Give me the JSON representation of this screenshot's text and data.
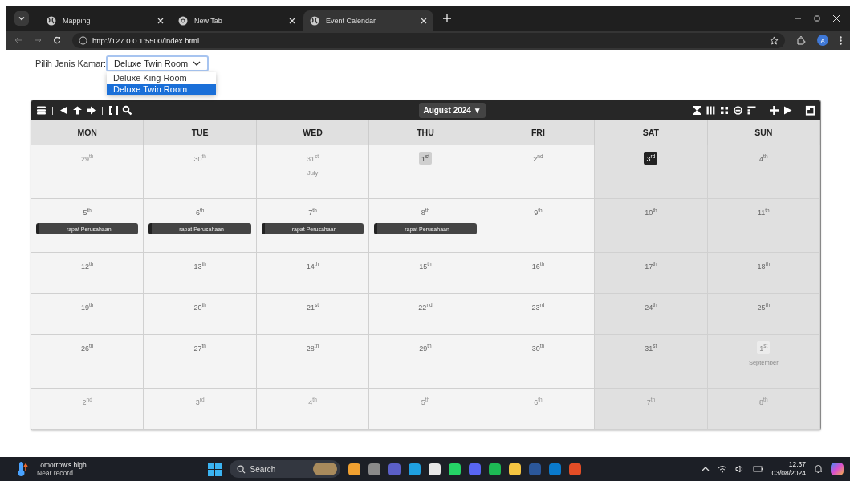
{
  "browser": {
    "tabs": [
      {
        "title": "Mapping",
        "selected": false
      },
      {
        "title": "New Tab",
        "selected": false
      },
      {
        "title": "Event Calendar",
        "selected": true
      }
    ],
    "url": "http://127.0.0.1:5500/index.html",
    "profile": "A"
  },
  "room_picker": {
    "label": "Pilih Jenis Kamar:",
    "value": "Deluxe Twin Room",
    "expanded": true,
    "options": [
      {
        "label": "Deluxe King Room",
        "selected": false
      },
      {
        "label": "Deluxe Twin Room",
        "selected": true
      }
    ]
  },
  "calendar": {
    "month_button": "August 2024 ▼",
    "columns": [
      {
        "label": "MON",
        "weekend": false
      },
      {
        "label": "TUE",
        "weekend": false
      },
      {
        "label": "WED",
        "weekend": false
      },
      {
        "label": "THU",
        "weekend": false
      },
      {
        "label": "FRI",
        "weekend": false
      },
      {
        "label": "SAT",
        "weekend": true
      },
      {
        "label": "SUN",
        "weekend": true
      }
    ],
    "weeks": [
      [
        {
          "label": "29$^{th}$",
          "other_month": true
        },
        {
          "label": "30$^{th}$",
          "other_month": true
        },
        {
          "label": "31$^{st}$",
          "other_month": true,
          "month": "July"
        },
        {
          "label": "1$^{st}$",
          "other_month": false,
          "highlighted": true
        },
        {
          "label": "2$^{nd}$",
          "other_month": false
        },
        {
          "label": "3$^{rd}$",
          "other_month": false,
          "today": true
        },
        {
          "label": "4$^{th}$",
          "other_month": false
        }
      ],
      [
        {
          "label": "5$^{th}$",
          "other_month": false,
          "events": [
            "rapat Perusahaan"
          ]
        },
        {
          "label": "6$^{th}$",
          "other_month": false,
          "events": [
            "rapat Perusahaan"
          ]
        },
        {
          "label": "7$^{th}$",
          "other_month": false,
          "events": [
            "rapat Perusahaan"
          ]
        },
        {
          "label": "8$^{th}$",
          "other_month": false,
          "events": [
            "rapat Perusahaan"
          ]
        },
        {
          "label": "9$^{th}$",
          "other_month": false
        },
        {
          "label": "10$^{th}$",
          "other_month": false
        },
        {
          "label": "11$^{th}$",
          "other_month": false
        }
      ],
      [
        {
          "label": "12$^{th}$",
          "other_month": false
        },
        {
          "label": "13$^{th}$",
          "other_month": false
        },
        {
          "label": "14$^{th}$",
          "other_month": false
        },
        {
          "label": "15$^{th}$",
          "other_month": false
        },
        {
          "label": "16$^{th}$",
          "other_month": false
        },
        {
          "label": "17$^{th}$",
          "other_month": false
        },
        {
          "label": "18$^{th}$",
          "other_month": false
        }
      ],
      [
        {
          "label": "19$^{th}$",
          "other_month": false
        },
        {
          "label": "20$^{th}$",
          "other_month": false
        },
        {
          "label": "21$^{st}$",
          "other_month": false
        },
        {
          "label": "22$^{nd}$",
          "other_month": false
        },
        {
          "label": "23$^{rd}$",
          "other_month": false
        },
        {
          "label": "24$^{th}$",
          "other_month": false
        },
        {
          "label": "25$^{th}$",
          "other_month": false
        }
      ],
      [
        {
          "label": "26$^{th}$",
          "other_month": false
        },
        {
          "label": "27$^{th}$",
          "other_month": false
        },
        {
          "label": "28$^{th}$",
          "other_month": false
        },
        {
          "label": "29$^{th}$",
          "other_month": false
        },
        {
          "label": "30$^{th}$",
          "other_month": false
        },
        {
          "label": "31$^{st}$",
          "other_month": false
        },
        {
          "label": "1$^{st}$",
          "other_month": true,
          "highlighted": true,
          "month": "September"
        }
      ],
      [
        {
          "label": "2$^{nd}$",
          "other_month": true
        },
        {
          "label": "3$^{rd}$",
          "other_month": true
        },
        {
          "label": "4$^{th}$",
          "other_month": true
        },
        {
          "label": "5$^{th}$",
          "other_month": true
        },
        {
          "label": "6$^{th}$",
          "other_month": true
        },
        {
          "label": "7$^{th}$",
          "other_month": true
        },
        {
          "label": "8$^{th}$",
          "other_month": true
        }
      ]
    ]
  },
  "taskbar": {
    "weather_title": "Tomorrow's high",
    "weather_subtitle": "Near record",
    "search_placeholder": "Search",
    "time": "12.37",
    "date": "03/08/2024"
  }
}
